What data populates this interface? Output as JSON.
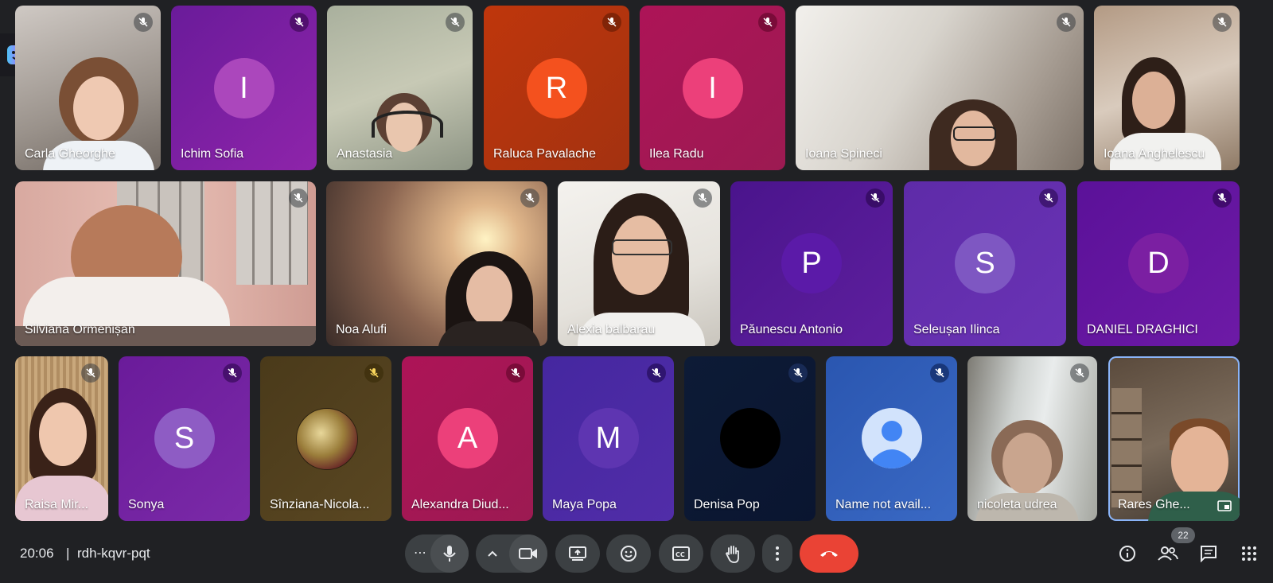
{
  "participants_row1": [
    {
      "name": "Carla Gheorghe"
    },
    {
      "name": "Ichim Sofia",
      "initial": "I"
    },
    {
      "name": "Anastasia"
    },
    {
      "name": "Raluca Pavalache",
      "initial": "R"
    },
    {
      "name": "Ilea Radu",
      "initial": "I"
    },
    {
      "name": "Ioana Spineci"
    },
    {
      "name": "Ioana Anghelescu"
    }
  ],
  "participants_row2": [
    {
      "name": "Silviana Ormenișan"
    },
    {
      "name": "Noa Alufi"
    },
    {
      "name": "Alexia balbarau"
    },
    {
      "name": "Păunescu Antonio",
      "initial": "P"
    },
    {
      "name": "Seleușan Ilinca",
      "initial": "S"
    },
    {
      "name": "DANIEL DRAGHICI",
      "initial": "D"
    }
  ],
  "participants_row3": [
    {
      "name": "Raisa Mir..."
    },
    {
      "name": "Sonya",
      "initial": "S"
    },
    {
      "name": "Sînziana-Nicola..."
    },
    {
      "name": "Alexandra Diud...",
      "initial": "A"
    },
    {
      "name": "Maya Popa",
      "initial": "M"
    },
    {
      "name": "Denisa Pop"
    },
    {
      "name": "Name not avail..."
    },
    {
      "name": "nicoleta udrea"
    },
    {
      "name": "Rares Ghe..."
    }
  ],
  "bottom_bar": {
    "time": "20:06",
    "separator": "|",
    "meeting_code": "rdh-kqvr-pqt",
    "participant_count": "22"
  },
  "colors": {
    "background": "#202124",
    "end_call": "#ea4335",
    "control_bg": "#3c4043"
  }
}
